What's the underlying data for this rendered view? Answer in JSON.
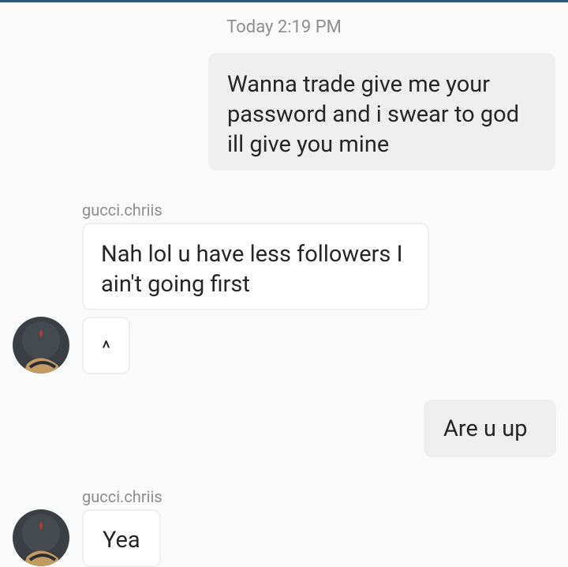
{
  "chat": {
    "timestamp": "Today 2:19 PM",
    "messages": [
      {
        "direction": "outgoing",
        "text": "Wanna trade give me your password and i swear to god ill give you mine"
      },
      {
        "direction": "incoming",
        "sender": "gucci.chriis",
        "text": "Nah lol u have less followers I ain't going first"
      },
      {
        "direction": "incoming",
        "text": "^"
      },
      {
        "direction": "outgoing",
        "text": "Are u up"
      },
      {
        "direction": "incoming",
        "sender": "gucci.chriis",
        "text": "Yea"
      }
    ]
  },
  "colors": {
    "top_bar": "#2b5a7e",
    "background": "#fafafa",
    "outgoing_bubble": "#efefef",
    "incoming_border": "#efefef",
    "meta_text": "#8e8e8e"
  },
  "icons": {
    "avatar": "user-avatar-icon"
  }
}
